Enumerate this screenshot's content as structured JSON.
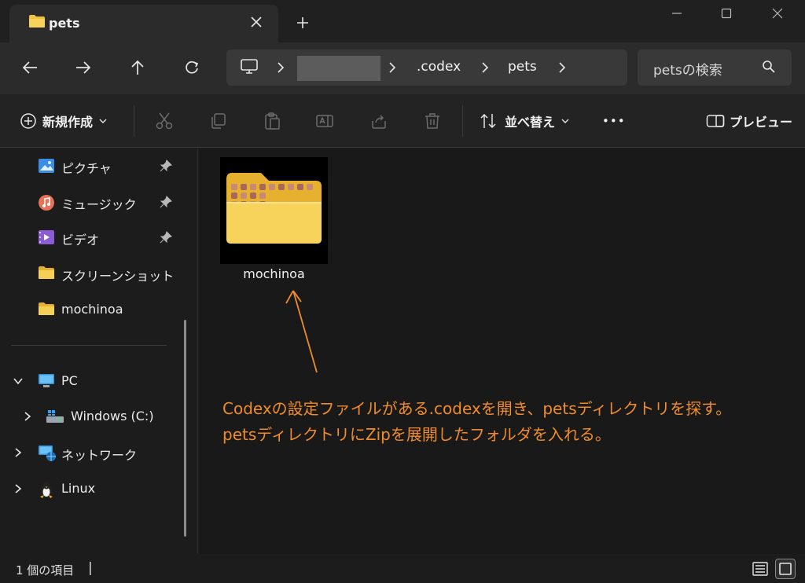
{
  "window": {
    "tab_title": "pets",
    "tab_close_glyph": "✕",
    "new_tab_glyph": "+"
  },
  "address": {
    "crumbs": [
      ".codex",
      "pets"
    ],
    "search_placeholder": "petsの検索"
  },
  "toolbar": {
    "new_label": "新規作成",
    "sort_label": "並べ替え",
    "more_glyph": "•••",
    "preview_label": "プレビュー"
  },
  "sidebar": {
    "quick": [
      {
        "label": "ピクチャ",
        "icon": "pictures-icon",
        "pinned": true
      },
      {
        "label": "ミュージック",
        "icon": "music-icon",
        "pinned": true
      },
      {
        "label": "ビデオ",
        "icon": "videos-icon",
        "pinned": true
      },
      {
        "label": "スクリーンショット",
        "icon": "folder-icon",
        "pinned": false
      },
      {
        "label": "mochinoa",
        "icon": "folder-icon",
        "pinned": false
      }
    ],
    "tree": [
      {
        "label": "PC",
        "icon": "pc-icon",
        "expanded": true
      },
      {
        "label": "Windows (C:)",
        "icon": "drive-icon",
        "expanded": false
      },
      {
        "label": "ネットワーク",
        "icon": "network-icon",
        "expanded": false
      },
      {
        "label": "Linux",
        "icon": "linux-icon",
        "expanded": false
      }
    ]
  },
  "content": {
    "items": [
      {
        "name": "mochinoa",
        "type": "folder"
      }
    ],
    "annotation_lines": [
      "Codexの設定ファイルがある.codexを開き、petsディレクトリを探す。",
      "petsディレクトリにZipを展開したフォルダを入れる。"
    ]
  },
  "status": {
    "item_count": "1 個の項目",
    "caret": "|"
  },
  "colors": {
    "accent": "#f08c2a",
    "folder": "#f3c23d"
  }
}
